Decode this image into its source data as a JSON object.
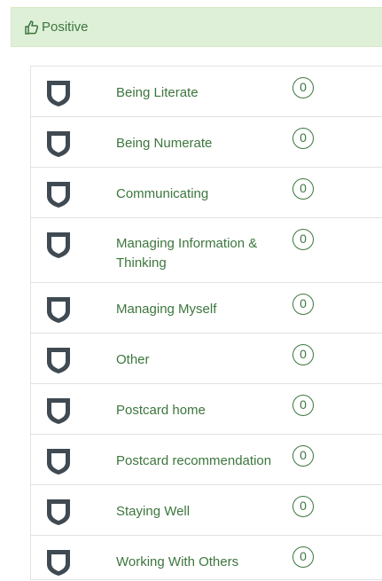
{
  "header": {
    "icon": "thumbs-up-icon",
    "title": "Positive",
    "color": "#3c763d",
    "background": "#dff0d8"
  },
  "items": [
    {
      "label": "Being Literate",
      "count": "0",
      "icon": "shield-icon"
    },
    {
      "label": "Being Numerate",
      "count": "0",
      "icon": "shield-icon"
    },
    {
      "label": "Communicating",
      "count": "0",
      "icon": "shield-icon"
    },
    {
      "label": "Managing Information & Thinking",
      "count": "0",
      "icon": "shield-icon"
    },
    {
      "label": "Managing Myself",
      "count": "0",
      "icon": "shield-icon"
    },
    {
      "label": "Other",
      "count": "0",
      "icon": "shield-icon"
    },
    {
      "label": "Postcard home",
      "count": "0",
      "icon": "shield-icon"
    },
    {
      "label": "Postcard recommendation",
      "count": "0",
      "icon": "shield-icon"
    },
    {
      "label": "Staying Well",
      "count": "0",
      "icon": "shield-icon"
    },
    {
      "label": "Working With Others",
      "count": "0",
      "icon": "shield-icon"
    }
  ]
}
